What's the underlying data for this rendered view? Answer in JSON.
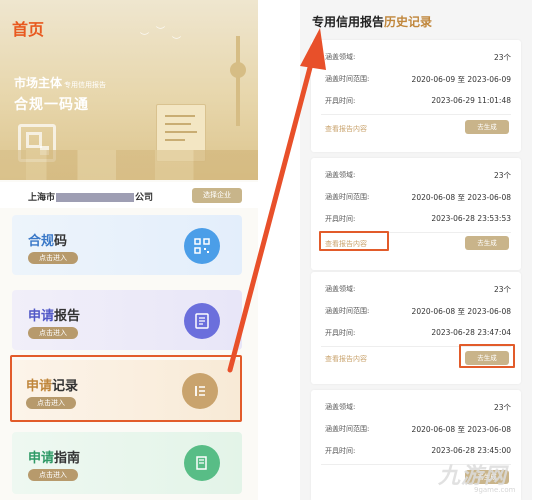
{
  "left_app": {
    "home_title": "首页",
    "hero_subtitle": "市场主体",
    "hero_subtitle_small": "专用信用报告",
    "hero_main": "合规一码通",
    "company_prefix": "上海市",
    "company_suffix": "公司",
    "switch_button": "选择企业",
    "menu": [
      {
        "label_a": "合规",
        "label_b": "码",
        "enter": "点击进入",
        "icon": "qr-code-icon"
      },
      {
        "label_a": "申请",
        "label_b": "报告",
        "enter": "点击进入",
        "icon": "document-icon"
      },
      {
        "label_a": "申请",
        "label_b": "记录",
        "enter": "点击进入",
        "icon": "list-icon"
      },
      {
        "label_a": "申请",
        "label_b": "指南",
        "enter": "点击进入",
        "icon": "guide-book-icon"
      }
    ]
  },
  "right_app": {
    "title_main": "专用信用报告",
    "title_accent": "历史记录",
    "labels": {
      "domains": "涵盖领域:",
      "time_range": "涵盖时间范围:",
      "open_time": "开具时间:",
      "view": "查看报告内容",
      "generate": "去生成"
    },
    "records": [
      {
        "domains": "23个",
        "range": "2020-06-09 至 2023-06-09",
        "opened": "2023-06-29 11:01:48"
      },
      {
        "domains": "23个",
        "range": "2020-06-08 至 2023-06-08",
        "opened": "2023-06-28 23:53:53"
      },
      {
        "domains": "23个",
        "range": "2020-06-08 至 2023-06-08",
        "opened": "2023-06-28 23:47:04"
      },
      {
        "domains": "23个",
        "range": "2020-06-08 至 2023-06-08",
        "opened": "2023-06-28 23:45:00"
      }
    ]
  },
  "watermark": {
    "main": "九游网",
    "sub": "9game.com"
  },
  "colors": {
    "highlight": "#e25b2a",
    "gold": "#c9a36d",
    "home_title": "#e8591f"
  }
}
